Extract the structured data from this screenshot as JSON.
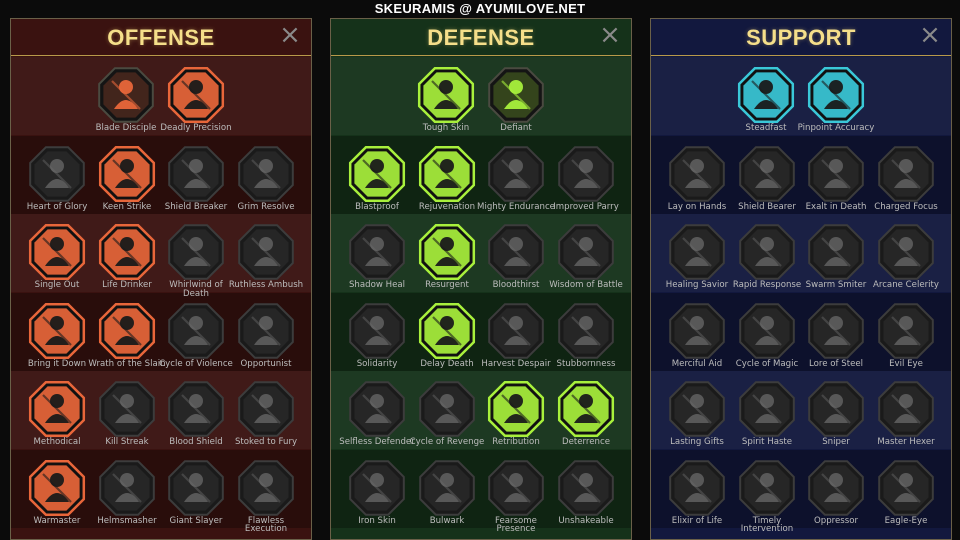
{
  "watermark": "SKEURAMIS @ AYUMILOVE.NET",
  "colors": {
    "offense_bg": "#3a1210",
    "defense_bg": "#15321a",
    "support_bg": "#12183e",
    "offense_active": "#e8663a",
    "defense_active": "#a8f03c",
    "support_active": "#3ac8d8",
    "title_gold": "#f5df8a"
  },
  "panels": [
    {
      "title": "OFFENSE",
      "close_icon": "close-icon",
      "rows": [
        [
          {
            "label": "Blade Disciple",
            "state": "dim-color",
            "icon": "crossed-swords-icon"
          },
          {
            "label": "Deadly Precision",
            "state": "active",
            "icon": "dagger-strike-icon"
          }
        ],
        [
          {
            "label": "Heart of Glory",
            "state": "inactive",
            "icon": "horned-warrior-icon"
          },
          {
            "label": "Keen Strike",
            "state": "active",
            "icon": "slash-icon"
          },
          {
            "label": "Shield Breaker",
            "state": "inactive",
            "icon": "broken-shield-icon"
          },
          {
            "label": "Grim Resolve",
            "state": "inactive",
            "icon": "heart-blade-icon"
          }
        ],
        [
          {
            "label": "Single Out",
            "state": "active",
            "icon": "arrows-target-icon"
          },
          {
            "label": "Life Drinker",
            "state": "active",
            "icon": "fanged-maw-icon"
          },
          {
            "label": "Whirlwind of Death",
            "state": "inactive",
            "icon": "whirlwind-icon"
          },
          {
            "label": "Ruthless Ambush",
            "state": "inactive",
            "icon": "ambush-icon"
          }
        ],
        [
          {
            "label": "Bring it Down",
            "state": "active",
            "icon": "sword-down-icon"
          },
          {
            "label": "Wrath of the Slain",
            "state": "active",
            "icon": "fist-icon"
          },
          {
            "label": "Cycle of Violence",
            "state": "inactive",
            "icon": "axes-icon"
          },
          {
            "label": "Opportunist",
            "state": "inactive",
            "icon": "chain-bolt-icon"
          }
        ],
        [
          {
            "label": "Methodical",
            "state": "active",
            "icon": "arrows-burst-icon"
          },
          {
            "label": "Kill Streak",
            "state": "inactive",
            "icon": "skull-icon"
          },
          {
            "label": "Blood Shield",
            "state": "inactive",
            "icon": "sword-shield-icon"
          },
          {
            "label": "Stoked to Fury",
            "state": "inactive",
            "icon": "fury-icon"
          }
        ],
        [
          {
            "label": "Warmaster",
            "state": "active",
            "icon": "war-sword-icon"
          },
          {
            "label": "Helmsmasher",
            "state": "inactive",
            "icon": "helmet-icon"
          },
          {
            "label": "Giant Slayer",
            "state": "inactive",
            "icon": "giant-icon"
          },
          {
            "label": "Flawless Execution",
            "state": "inactive",
            "icon": "skull-blade-icon"
          }
        ]
      ]
    },
    {
      "title": "DEFENSE",
      "close_icon": "close-icon",
      "rows": [
        [
          {
            "label": "Tough Skin",
            "state": "active",
            "icon": "scales-icon"
          },
          {
            "label": "Defiant",
            "state": "dim-color",
            "icon": "raised-fist-icon"
          }
        ],
        [
          {
            "label": "Blastproof",
            "state": "active",
            "icon": "chevron-shield-icon"
          },
          {
            "label": "Rejuvenation",
            "state": "active",
            "icon": "potion-hand-icon"
          },
          {
            "label": "Mighty Endurance",
            "state": "inactive",
            "icon": "muscle-icon"
          },
          {
            "label": "Improved Parry",
            "state": "inactive",
            "icon": "parry-icon"
          }
        ],
        [
          {
            "label": "Shadow Heal",
            "state": "inactive",
            "icon": "shadow-figure-icon"
          },
          {
            "label": "Resurgent",
            "state": "active",
            "icon": "knight-shield-icon"
          },
          {
            "label": "Bloodthirst",
            "state": "inactive",
            "icon": "blood-heart-icon"
          },
          {
            "label": "Wisdom of Battle",
            "state": "inactive",
            "icon": "sage-icon"
          }
        ],
        [
          {
            "label": "Solidarity",
            "state": "inactive",
            "icon": "crowd-icon"
          },
          {
            "label": "Delay Death",
            "state": "active",
            "icon": "hourglass-icon"
          },
          {
            "label": "Harvest Despair",
            "state": "inactive",
            "icon": "open-hand-icon"
          },
          {
            "label": "Stubbornness",
            "state": "inactive",
            "icon": "bull-icon"
          }
        ],
        [
          {
            "label": "Selfless Defender",
            "state": "inactive",
            "icon": "runner-icon"
          },
          {
            "label": "Cycle of Revenge",
            "state": "inactive",
            "icon": "drops-icon"
          },
          {
            "label": "Retribution",
            "state": "active",
            "icon": "sun-skull-icon"
          },
          {
            "label": "Deterrence",
            "state": "active",
            "icon": "deflect-icon"
          }
        ],
        [
          {
            "label": "Iron Skin",
            "state": "inactive",
            "icon": "iron-man-icon"
          },
          {
            "label": "Bulwark",
            "state": "inactive",
            "icon": "bulwark-icon"
          },
          {
            "label": "Fearsome Presence",
            "state": "inactive",
            "icon": "fearsome-icon"
          },
          {
            "label": "Unshakeable",
            "state": "inactive",
            "icon": "strongman-icon"
          }
        ]
      ]
    },
    {
      "title": "SUPPORT",
      "close_icon": "close-icon",
      "rows": [
        [
          {
            "label": "Steadfast",
            "state": "active",
            "icon": "hands-heart-icon"
          },
          {
            "label": "Pinpoint Accuracy",
            "state": "active",
            "icon": "target-hand-icon"
          }
        ],
        [
          {
            "label": "Lay on Hands",
            "state": "inactive",
            "icon": "praying-hands-icon"
          },
          {
            "label": "Shield Bearer",
            "state": "inactive",
            "icon": "shield-arc-icon"
          },
          {
            "label": "Exalt in Death",
            "state": "inactive",
            "icon": "skull-potion-icon"
          },
          {
            "label": "Charged Focus",
            "state": "inactive",
            "icon": "charged-arrow-icon"
          }
        ],
        [
          {
            "label": "Healing Savior",
            "state": "inactive",
            "icon": "healer-icon"
          },
          {
            "label": "Rapid Response",
            "state": "inactive",
            "icon": "lightning-shield-icon"
          },
          {
            "label": "Swarm Smiter",
            "state": "inactive",
            "icon": "swarm-icon"
          },
          {
            "label": "Arcane Celerity",
            "state": "inactive",
            "icon": "figures-icon"
          }
        ],
        [
          {
            "label": "Merciful Aid",
            "state": "inactive",
            "icon": "chained-heart-icon"
          },
          {
            "label": "Cycle of Magic",
            "state": "inactive",
            "icon": "comet-icon"
          },
          {
            "label": "Lore of Steel",
            "state": "inactive",
            "icon": "book-icon"
          },
          {
            "label": "Evil Eye",
            "state": "inactive",
            "icon": "evil-eye-icon"
          }
        ],
        [
          {
            "label": "Lasting Gifts",
            "state": "inactive",
            "icon": "star-compass-icon"
          },
          {
            "label": "Spirit Haste",
            "state": "inactive",
            "icon": "boot-icon"
          },
          {
            "label": "Sniper",
            "state": "inactive",
            "icon": "eye-icon"
          },
          {
            "label": "Master Hexer",
            "state": "inactive",
            "icon": "hexer-icon"
          }
        ],
        [
          {
            "label": "Elixir of Life",
            "state": "inactive",
            "icon": "flask-icon"
          },
          {
            "label": "Timely Intervention",
            "state": "inactive",
            "icon": "reaper-icon"
          },
          {
            "label": "Oppressor",
            "state": "inactive",
            "icon": "gauntlet-icon"
          },
          {
            "label": "Eagle-Eye",
            "state": "inactive",
            "icon": "eagle-icon"
          }
        ]
      ]
    }
  ]
}
